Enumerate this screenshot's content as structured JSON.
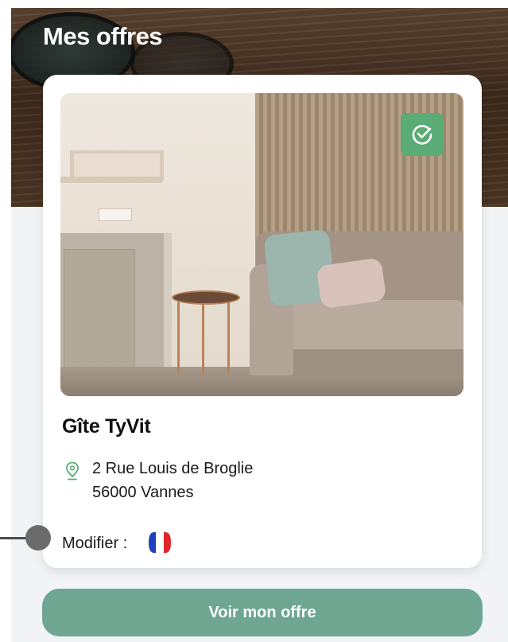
{
  "header": {
    "title": "Mes offres"
  },
  "offer": {
    "title": "Gîte TyVit",
    "address_line1": "2 Rue Louis de Broglie",
    "address_line2": "56000 Vannes",
    "edit_label": "Modifier :",
    "verified": true,
    "edit_language_icon": "france-flag-icon"
  },
  "actions": {
    "view_offer_label": "Voir mon offre"
  },
  "colors": {
    "accent": "#6ea692",
    "badge": "#5aab75",
    "pin": "#5aab75",
    "flag_blue": "#1f3fbf",
    "flag_red": "#e2262c"
  }
}
